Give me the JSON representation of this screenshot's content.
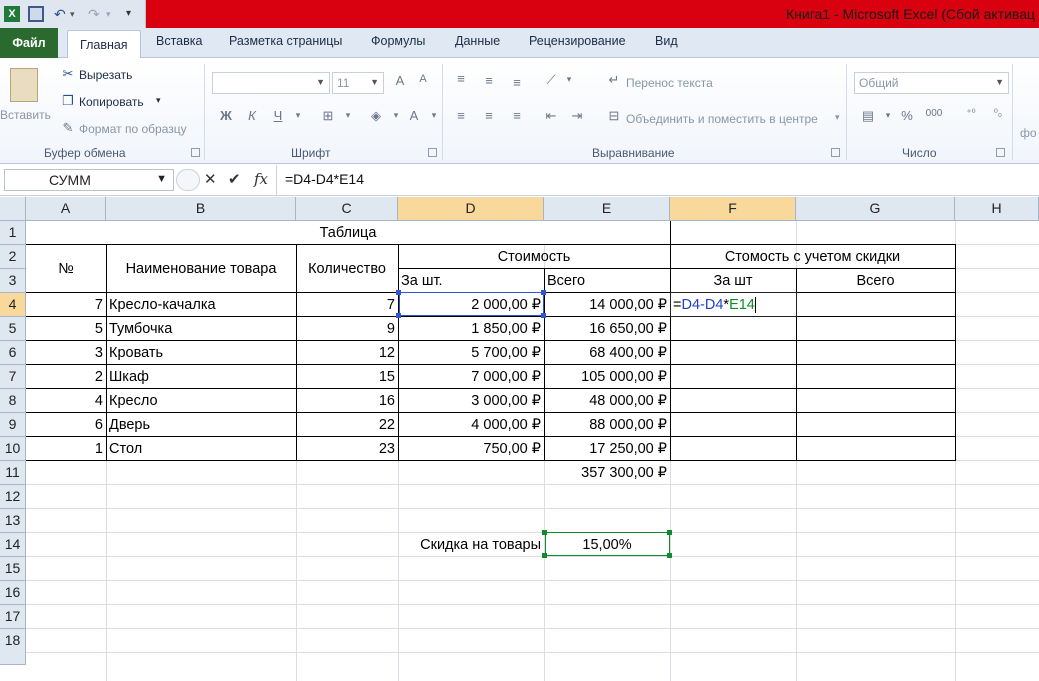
{
  "window": {
    "title": "Книга1 - Microsoft Excel (Сбой активац"
  },
  "tabs": [
    "Файл",
    "Главная",
    "Вставка",
    "Разметка страницы",
    "Формулы",
    "Данные",
    "Рецензирование",
    "Вид"
  ],
  "ribbon": {
    "clipboard": {
      "paste": "Вставить",
      "cut": "Вырезать",
      "copy": "Копировать",
      "format_painter": "Формат по образцу",
      "label": "Буфер обмена"
    },
    "font": {
      "label": "Шрифт",
      "size": "11",
      "bold": "Ж",
      "italic": "К",
      "underline": "Ч"
    },
    "alignment": {
      "label": "Выравнивание",
      "wrap": "Перенос текста",
      "merge": "Объединить и поместить в центре"
    },
    "number": {
      "label": "Число",
      "format": "Общий",
      "percent": "%",
      "thousands": "000"
    },
    "styles_partial": "фо"
  },
  "formula_bar": {
    "name_box": "СУММ",
    "fx": "fx",
    "formula": "=D4-D4*E14"
  },
  "columns": [
    "A",
    "B",
    "C",
    "D",
    "E",
    "F",
    "G",
    "H"
  ],
  "rows": [
    "1",
    "2",
    "3",
    "4",
    "5",
    "6",
    "7",
    "8",
    "9",
    "10",
    "11",
    "12",
    "13",
    "14",
    "15",
    "16",
    "17",
    "18"
  ],
  "sheet": {
    "title": "Таблица",
    "headers": {
      "num": "№",
      "name": "Наименование товара",
      "qty": "Количество",
      "cost": "Стоимость",
      "cost_discount": "Стомость с учетом скидки",
      "per_unit": "За шт.",
      "total": "Всего",
      "per_unit_disc": "За шт",
      "total_disc": "Всего"
    },
    "items": [
      {
        "num": "7",
        "name": "Кресло-качалка",
        "qty": "7",
        "price": "2 000,00 ₽",
        "total": "14 000,00 ₽"
      },
      {
        "num": "5",
        "name": "Тумбочка",
        "qty": "9",
        "price": "1 850,00 ₽",
        "total": "16 650,00 ₽"
      },
      {
        "num": "3",
        "name": "Кровать",
        "qty": "12",
        "price": "5 700,00 ₽",
        "total": "68 400,00 ₽"
      },
      {
        "num": "2",
        "name": "Шкаф",
        "qty": "15",
        "price": "7 000,00 ₽",
        "total": "105 000,00 ₽"
      },
      {
        "num": "4",
        "name": "Кресло",
        "qty": "16",
        "price": "3 000,00 ₽",
        "total": "48 000,00 ₽"
      },
      {
        "num": "6",
        "name": "Дверь",
        "qty": "22",
        "price": "4 000,00 ₽",
        "total": "88 000,00 ₽"
      },
      {
        "num": "1",
        "name": "Стол",
        "qty": "23",
        "price": "750,00 ₽",
        "total": "17 250,00 ₽"
      }
    ],
    "grand_total": "357 300,00 ₽",
    "discount_label": "Скидка на товары",
    "discount_value": "15,00%",
    "edit_formula": {
      "eq": "=",
      "ref1": "D4",
      "op1": "-",
      "ref2": "D4",
      "op2": "*",
      "ref3": "E14"
    }
  },
  "colors": {
    "title_bar": "#d9000f",
    "file_tab": "#2a6a2f",
    "ref_blue": "#1f3fcf",
    "ref_green": "#138a2a",
    "header_selected": "#f9d99b"
  }
}
